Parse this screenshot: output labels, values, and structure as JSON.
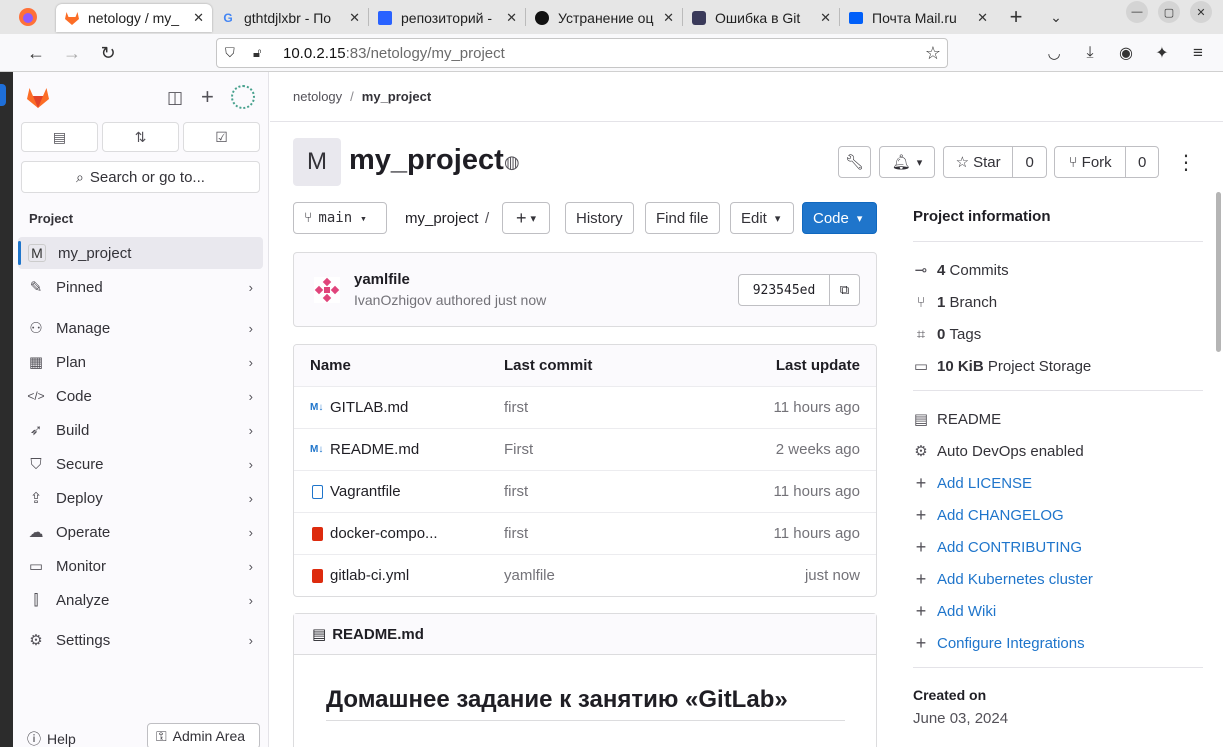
{
  "browser": {
    "tabs": [
      {
        "title": "netology / my_",
        "favicon": "gitlab-icon",
        "active": true
      },
      {
        "title": "gthtdjlxbr - По",
        "favicon": "google-icon",
        "active": false
      },
      {
        "title": "репозиторий -",
        "favicon": "yandex-icon",
        "active": false
      },
      {
        "title": "Устранение оц",
        "favicon": "github-icon",
        "active": false
      },
      {
        "title": "Ошибка в Git",
        "favicon": "dark-app-icon",
        "active": false
      },
      {
        "title": "Почта Mail.ru",
        "favicon": "mail-icon",
        "active": false
      }
    ],
    "url_host": "10.0.2.15",
    "url_rest": ":83/netology/my_project"
  },
  "sidebar": {
    "section_label": "Project",
    "search_label": "Search or go to...",
    "project_avatar_letter": "M",
    "items": [
      {
        "label": "my_project",
        "icon": "project-avatar"
      },
      {
        "label": "Pinned",
        "icon": "pin-icon"
      },
      {
        "label": "Manage",
        "icon": "users-icon"
      },
      {
        "label": "Plan",
        "icon": "calendar-icon"
      },
      {
        "label": "Code",
        "icon": "code-icon"
      },
      {
        "label": "Build",
        "icon": "rocket-icon"
      },
      {
        "label": "Secure",
        "icon": "shield-icon"
      },
      {
        "label": "Deploy",
        "icon": "deploy-icon"
      },
      {
        "label": "Operate",
        "icon": "cloud-gear-icon"
      },
      {
        "label": "Monitor",
        "icon": "monitor-icon"
      },
      {
        "label": "Analyze",
        "icon": "chart-icon"
      },
      {
        "label": "Settings",
        "icon": "gear-icon"
      }
    ],
    "help_label": "Help",
    "admin_label": "Admin Area"
  },
  "breadcrumb": {
    "group": "netology",
    "project": "my_project"
  },
  "project": {
    "avatar_letter": "M",
    "name": "my_project",
    "star_label": "Star",
    "star_count": "0",
    "fork_label": "Fork",
    "fork_count": "0"
  },
  "repo_toolbar": {
    "branch": "main",
    "path": "my_project",
    "path_sep": "/",
    "history": "History",
    "find_file": "Find file",
    "edit": "Edit",
    "code": "Code"
  },
  "last_commit": {
    "message": "yamlfile",
    "author": "IvanOzhigov",
    "authored_text": "authored just now",
    "sha": "923545ed"
  },
  "file_table": {
    "headers": {
      "name": "Name",
      "last_commit": "Last commit",
      "last_update": "Last update"
    },
    "rows": [
      {
        "name": "GITLAB.md",
        "icon": "markdown-icon",
        "commit": "first",
        "updated": "11 hours ago"
      },
      {
        "name": "README.md",
        "icon": "markdown-icon",
        "commit": "First",
        "updated": "2 weeks ago"
      },
      {
        "name": "Vagrantfile",
        "icon": "file-icon",
        "commit": "first",
        "updated": "11 hours ago"
      },
      {
        "name": "docker-compo...",
        "icon": "yaml-icon",
        "commit": "first",
        "updated": "11 hours ago"
      },
      {
        "name": "gitlab-ci.yml",
        "icon": "yaml-icon",
        "commit": "yamlfile",
        "updated": "just now"
      }
    ]
  },
  "readme": {
    "file_label": "README.md",
    "heading": "Домашнее задание к занятию «GitLab»"
  },
  "project_info": {
    "title": "Project information",
    "stats": [
      {
        "count": "4",
        "label": "Commits",
        "icon": "commit-icon"
      },
      {
        "count": "1",
        "label": "Branch",
        "icon": "branch-icon"
      },
      {
        "count": "0",
        "label": "Tags",
        "icon": "tag-icon"
      },
      {
        "count": "10 KiB",
        "label": "Project Storage",
        "icon": "storage-icon"
      }
    ],
    "readme_label": "README",
    "autodevops_label": "Auto DevOps enabled",
    "add_links": [
      "Add LICENSE",
      "Add CHANGELOG",
      "Add CONTRIBUTING",
      "Add Kubernetes cluster",
      "Add Wiki",
      "Configure Integrations"
    ],
    "created_label": "Created on",
    "created_date": "June 03, 2024"
  },
  "colors": {
    "accent": "#1f75cb",
    "sidebar_bg": "#fbfafd",
    "gitlab_orange": "#fc6d26"
  }
}
